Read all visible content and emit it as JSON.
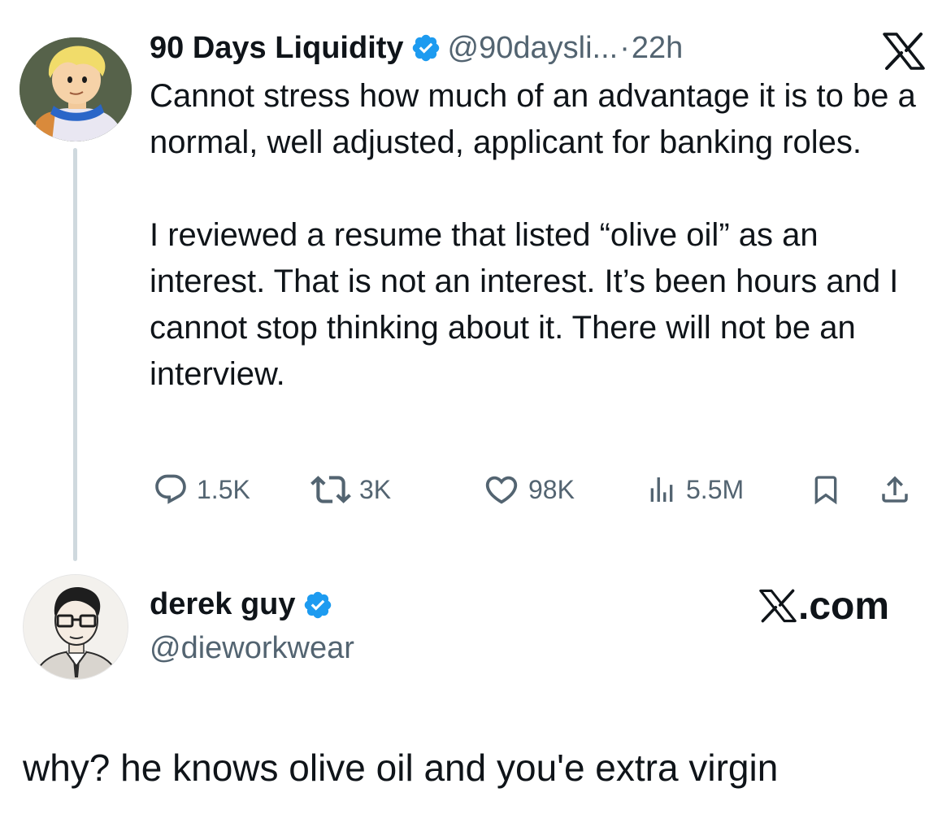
{
  "tweet": {
    "author": {
      "name": "90 Days Liquidity",
      "handle": "@90daysli...",
      "separator": "·",
      "time": "22h",
      "avatar": "cartoon-avatar"
    },
    "paragraphs": [
      "Cannot stress how much of an advantage it is to be a normal, well adjusted, applicant for banking roles.",
      "I reviewed a resume that listed “olive oil” as an interest. That is not an interest. It’s been hours and I cannot stop thinking about it. There will not be an interview."
    ],
    "stats": {
      "replies": "1.5K",
      "reposts": "3K",
      "likes": "98K",
      "views": "5.5M"
    },
    "icons": {
      "reply": "reply-icon",
      "repost": "repost-icon",
      "like": "heart-icon",
      "views": "views-icon",
      "bookmark": "bookmark-icon",
      "share": "share-icon",
      "verified": "verified-badge-icon",
      "platform": "x-logo-icon"
    }
  },
  "reply": {
    "author": {
      "name": "derek guy",
      "handle": "@dieworkwear",
      "avatar": "sketch-portrait-avatar"
    },
    "watermark": "X.com",
    "text": "why? he knows olive oil and you'e extra virgin"
  },
  "colors": {
    "text": "#0f1419",
    "secondary": "#536471",
    "verified_blue": "#1d9bf0",
    "thread_line": "#cfd9de"
  }
}
